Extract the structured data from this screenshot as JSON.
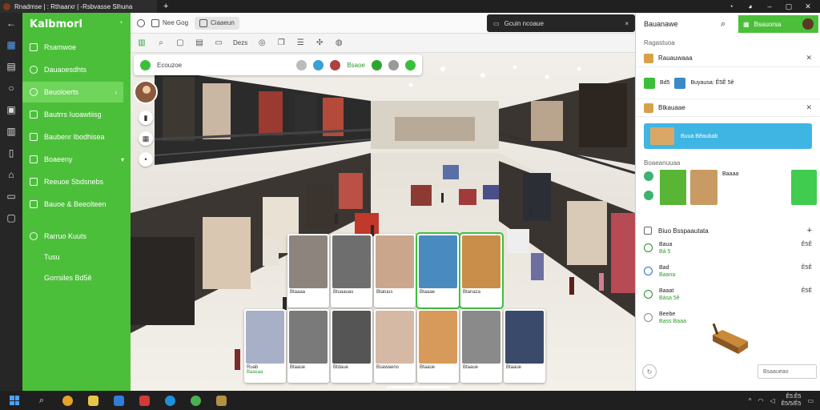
{
  "window": {
    "tab_title": "Rnadmse | : Rthaarxr | -Rsbvasse Slhuna",
    "newtab_label": "+"
  },
  "sidebar": {
    "brand": "Kalbmorl",
    "items": [
      {
        "label": "Rsamwoe"
      },
      {
        "label": "Dauaoesdhts"
      },
      {
        "label": "Beuoloerts"
      },
      {
        "label": "Bautrrs Iuoawtiisg"
      },
      {
        "label": "Baubenr Ibodhisea"
      },
      {
        "label": "Boaeeny"
      },
      {
        "label": "Reeuoe Sbdsnebs"
      },
      {
        "label": "Bauoe & Beeolteen"
      },
      {
        "label": "Rarruo Kuuts"
      }
    ],
    "subitems": [
      {
        "label": "Tusu"
      },
      {
        "label": "Gorrsiles Bd5ê"
      }
    ]
  },
  "toolbar": {
    "item1": "Nee Gog",
    "item2": "Ciaaeun",
    "item3": "Dezs",
    "search_text": "Gcuin ncoaue",
    "close": "×"
  },
  "floatbar": {
    "label": "Ecouzoe",
    "tag": "Bsaoe"
  },
  "cards": [
    {
      "cap": "Btaaaa",
      "cap2": ""
    },
    {
      "cap": "Btuaauas",
      "cap2": ""
    },
    {
      "cap": "Btatuus",
      "cap2": ""
    },
    {
      "cap": "Btaaae",
      "cap2": ""
    },
    {
      "cap": "Btanaza",
      "cap2": ""
    },
    {
      "cap": "Ruab",
      "cap2": "Baasaa"
    },
    {
      "cap": "Btaaue",
      "cap2": ""
    },
    {
      "cap": "Btdaue",
      "cap2": ""
    },
    {
      "cap": "Bsawaeno",
      "cap2": ""
    },
    {
      "cap": "Btaaue",
      "cap2": ""
    },
    {
      "cap": "Btaaue",
      "cap2": ""
    },
    {
      "cap": "Btaaue",
      "cap2": ""
    }
  ],
  "rpanel": {
    "title": "Bauanawe",
    "user_button": "Bsauorsa",
    "section1": "Ragastuoa",
    "row1": "Rauauwaaa",
    "media_label_a": "Bd5",
    "media_label_b": "Buyausa: Ê5Ê 5ê",
    "row2": "Btkauaae",
    "banner_text": "Buua Bêaubab",
    "section2": "Boaeanuuaa",
    "tile_label": "Baaaa",
    "list_header": "Biuo Bsspaautata",
    "list": [
      {
        "title": "Baua",
        "sub": "Bà 5",
        "amount": "Ê5Ê"
      },
      {
        "title": "Bad",
        "sub": "Baana",
        "amount": "Ê5Ê"
      },
      {
        "title": "Baaat",
        "sub": "Bàsa 5ê",
        "amount": "Ê5Ê"
      },
      {
        "title": "Beebe",
        "sub": "Bass Baaa",
        "amount": ""
      }
    ],
    "footer_button": "Bsaaueao"
  },
  "taskbar": {
    "time": "Ê5:Ê5",
    "date": "Ê5/5/Ê5"
  }
}
